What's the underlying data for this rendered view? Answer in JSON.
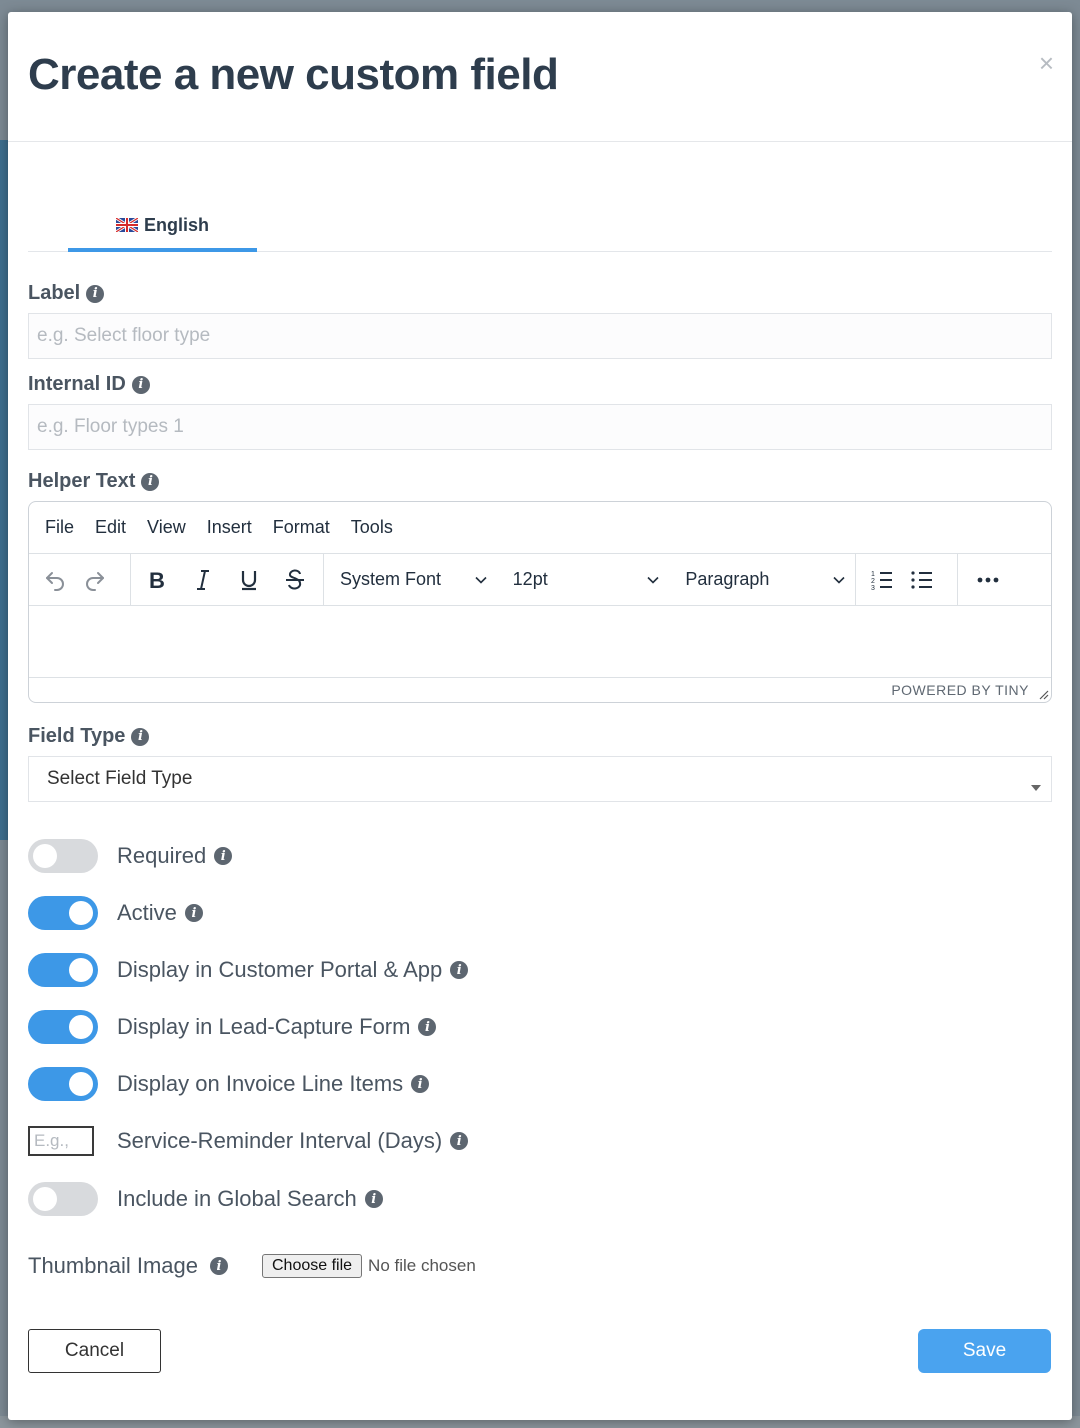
{
  "modal": {
    "title": "Create a new custom field",
    "close_glyph": "×"
  },
  "tabs": [
    {
      "label": "English",
      "icon": "uk-flag-icon",
      "active": true
    }
  ],
  "fields": {
    "label": {
      "label": "Label",
      "placeholder": "e.g. Select floor type",
      "value": ""
    },
    "internal_id": {
      "label": "Internal ID",
      "placeholder": "e.g. Floor types 1",
      "value": ""
    },
    "helper_text": {
      "label": "Helper Text"
    },
    "field_type": {
      "label": "Field Type",
      "selected": "Select Field Type"
    }
  },
  "editor": {
    "menu": [
      "File",
      "Edit",
      "View",
      "Insert",
      "Format",
      "Tools"
    ],
    "font": "System Font",
    "size": "12pt",
    "block": "Paragraph",
    "branding": "POWERED BY TINY"
  },
  "toggles": [
    {
      "label": "Required",
      "on": false
    },
    {
      "label": "Active",
      "on": true
    },
    {
      "label": "Display in Customer Portal & App",
      "on": true
    },
    {
      "label": "Display in Lead-Capture Form",
      "on": true
    },
    {
      "label": "Display on Invoice Line Items",
      "on": true
    }
  ],
  "interval": {
    "label": "Service-Reminder Interval (Days)",
    "placeholder": "E.g.,"
  },
  "global_search": {
    "label": "Include in Global Search",
    "on": false
  },
  "thumbnail": {
    "label": "Thumbnail Image",
    "button": "Choose file",
    "status": "No file chosen"
  },
  "buttons": {
    "cancel": "Cancel",
    "save": "Save"
  },
  "colors": {
    "accent": "#3d98e7",
    "save": "#4aa3ef",
    "title": "#2e3d4d",
    "toggle_off": "#d8dadd"
  },
  "info_glyph": "i"
}
